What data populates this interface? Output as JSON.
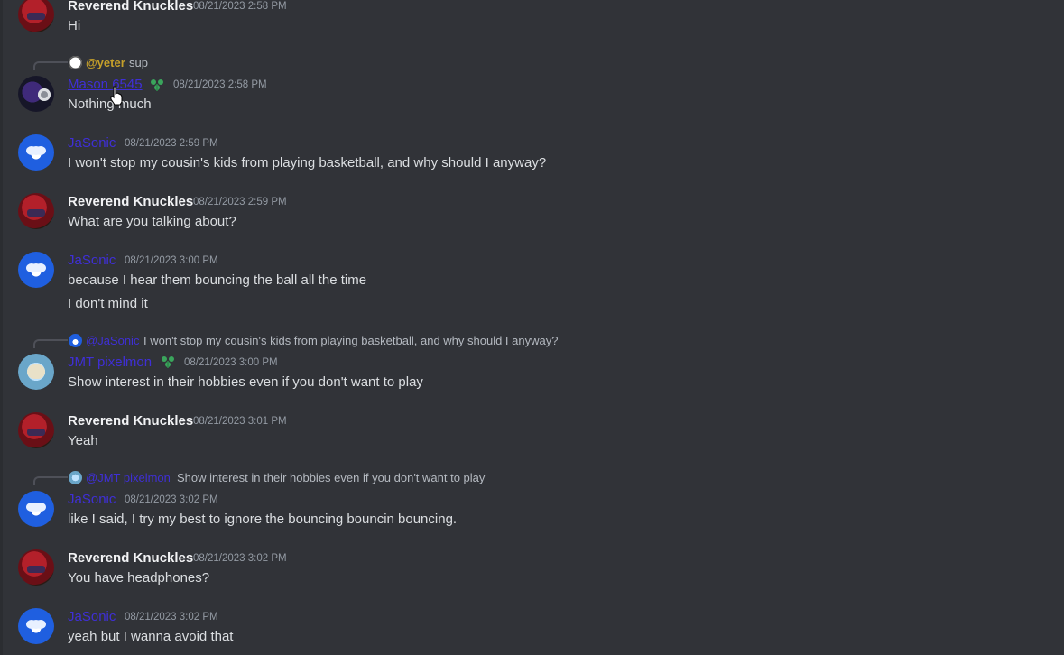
{
  "messages": [
    {
      "author": "Reverend Knuckles",
      "time": "08/21/2023 2:58 PM",
      "lines": [
        "Hi"
      ]
    },
    {
      "reply": {
        "name": "@yeter",
        "text": "sup"
      },
      "author": "Mason 6545",
      "time": "08/21/2023 2:58 PM",
      "lines": [
        "Nothing much"
      ],
      "badge_icon": "leaf-badge-icon"
    },
    {
      "author": "JaSonic",
      "time": "08/21/2023 2:59 PM",
      "lines": [
        "I won't stop my cousin's kids from playing basketball, and why should I anyway?"
      ]
    },
    {
      "author": "Reverend Knuckles",
      "time": "08/21/2023 2:59 PM",
      "lines": [
        "What are you talking about?"
      ]
    },
    {
      "author": "JaSonic",
      "time": "08/21/2023 3:00 PM",
      "lines": [
        "because I hear them bouncing the ball all the time",
        "I don't mind it"
      ]
    },
    {
      "reply": {
        "name": "@JaSonic",
        "text": "I won't stop my cousin's kids from playing basketball, and why should I anyway?"
      },
      "author": "JMT pixelmon",
      "time": "08/21/2023 3:00 PM",
      "lines": [
        "Show interest in their hobbies even if you don't want to play"
      ],
      "badge_icon": "leaf-badge-icon"
    },
    {
      "author": "Reverend Knuckles",
      "time": "08/21/2023 3:01 PM",
      "lines": [
        "Yeah"
      ]
    },
    {
      "reply": {
        "name": "@JMT pixelmon",
        "text": "Show interest in their hobbies even if you don't want to play"
      },
      "author": "JaSonic",
      "time": "08/21/2023 3:02 PM",
      "lines": [
        "like I said, I try my best to ignore the bouncing bouncin bouncing."
      ]
    },
    {
      "author": "Reverend Knuckles",
      "time": "08/21/2023 3:02 PM",
      "lines": [
        "You have headphones?"
      ]
    },
    {
      "author": "JaSonic",
      "time": "08/21/2023 3:02 PM",
      "lines": [
        "yeah but I wanna avoid that"
      ]
    }
  ],
  "colors": {
    "background": "#313338",
    "text": "#dbdee1",
    "timestamp": "#949ba4",
    "blue_name": "#3f2fd6",
    "yeter": "#c6a02a"
  },
  "cursor_icon": "hand-pointer-icon"
}
